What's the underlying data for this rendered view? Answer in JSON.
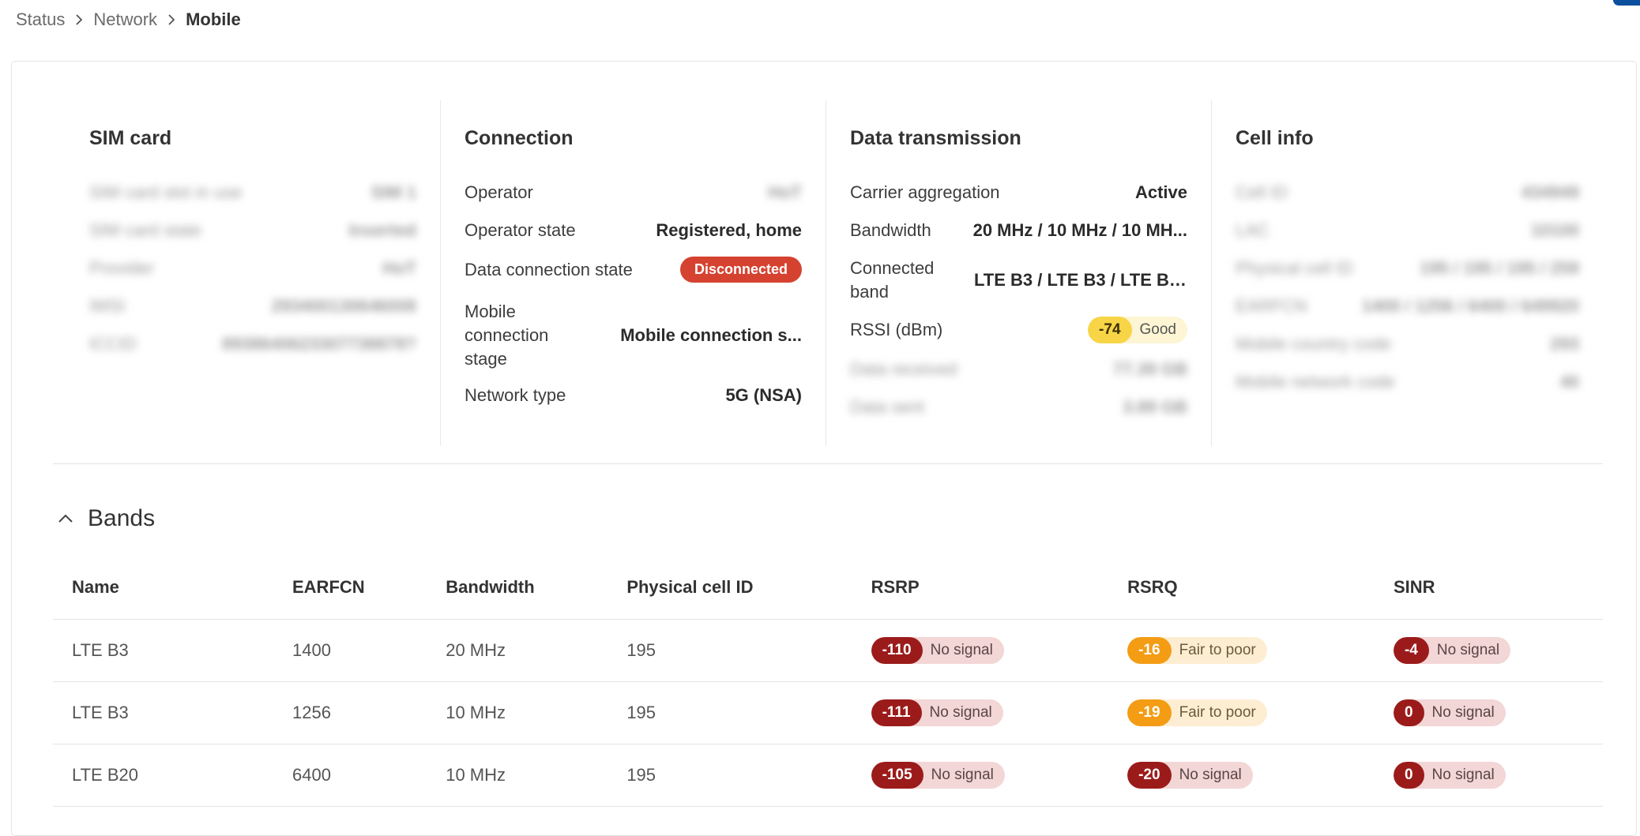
{
  "breadcrumb": [
    "Status",
    "Network",
    "Mobile"
  ],
  "sim_card": {
    "title": "SIM card",
    "rows": [
      {
        "label": "SIM card slot in use",
        "value": "SIM 1"
      },
      {
        "label": "SIM card state",
        "value": "Inserted"
      },
      {
        "label": "Provider",
        "value": "HoT"
      },
      {
        "label": "IMSI",
        "value": "293400130646008"
      },
      {
        "label": "ICCID",
        "value": "8938640623307738878?"
      }
    ]
  },
  "connection": {
    "title": "Connection",
    "operator_label": "Operator",
    "operator_value": "HoT",
    "operator_state_label": "Operator state",
    "operator_state_value": "Registered, home",
    "data_state_label": "Data connection state",
    "data_state_value": "Disconnected",
    "stage_label": "Mobile connection stage",
    "stage_value": "Mobile connection s...",
    "network_type_label": "Network type",
    "network_type_value": "5G (NSA)"
  },
  "data_transmission": {
    "title": "Data transmission",
    "ca_label": "Carrier aggregation",
    "ca_value": "Active",
    "bandwidth_label": "Bandwidth",
    "bandwidth_value": "20 MHz / 10 MHz / 10 MH...",
    "band_label": "Connected band",
    "band_value": "LTE B3 / LTE B3 / LTE B2...",
    "rssi_label": "RSSI (dBm)",
    "rssi_value": "-74",
    "rssi_quality": "Good",
    "received_label": "Data received",
    "received_value": "77.39 GB",
    "sent_label": "Data sent",
    "sent_value": "3.89 GB"
  },
  "cell_info": {
    "title": "Cell info",
    "rows": [
      {
        "label": "Cell ID",
        "value": "434949"
      },
      {
        "label": "LAC",
        "value": "10100"
      },
      {
        "label": "Physical cell ID",
        "value": "195 / 195 / 195 / 259"
      },
      {
        "label": "EARFCN",
        "value": "1400 / 1256 / 6400 / 649920"
      },
      {
        "label": "Mobile country code",
        "value": "293"
      },
      {
        "label": "Mobile network code",
        "value": "40"
      }
    ]
  },
  "bands": {
    "title": "Bands",
    "columns": [
      "Name",
      "EARFCN",
      "Bandwidth",
      "Physical cell ID",
      "RSRP",
      "RSRQ",
      "SINR"
    ],
    "rows": [
      {
        "name": "LTE B3",
        "earfcn": "1400",
        "bandwidth": "20 MHz",
        "pci": "195",
        "rsrp": "-110",
        "rsrp_q": "No signal",
        "rsrq": "-16",
        "rsrq_q": "Fair to poor",
        "sinr": "-4",
        "sinr_q": "No signal"
      },
      {
        "name": "LTE B3",
        "earfcn": "1256",
        "bandwidth": "10 MHz",
        "pci": "195",
        "rsrp": "-111",
        "rsrp_q": "No signal",
        "rsrq": "-19",
        "rsrq_q": "Fair to poor",
        "sinr": "0",
        "sinr_q": "No signal"
      },
      {
        "name": "LTE B20",
        "earfcn": "6400",
        "bandwidth": "10 MHz",
        "pci": "195",
        "rsrp": "-105",
        "rsrp_q": "No signal",
        "rsrq": "-20",
        "rsrq_q": "No signal",
        "sinr": "0",
        "sinr_q": "No signal"
      }
    ]
  },
  "colors": {
    "disconnected": "#d64230",
    "good": "#f7d547",
    "no_signal": "#9b1b1b",
    "fair_to_poor": "#f39c14"
  }
}
